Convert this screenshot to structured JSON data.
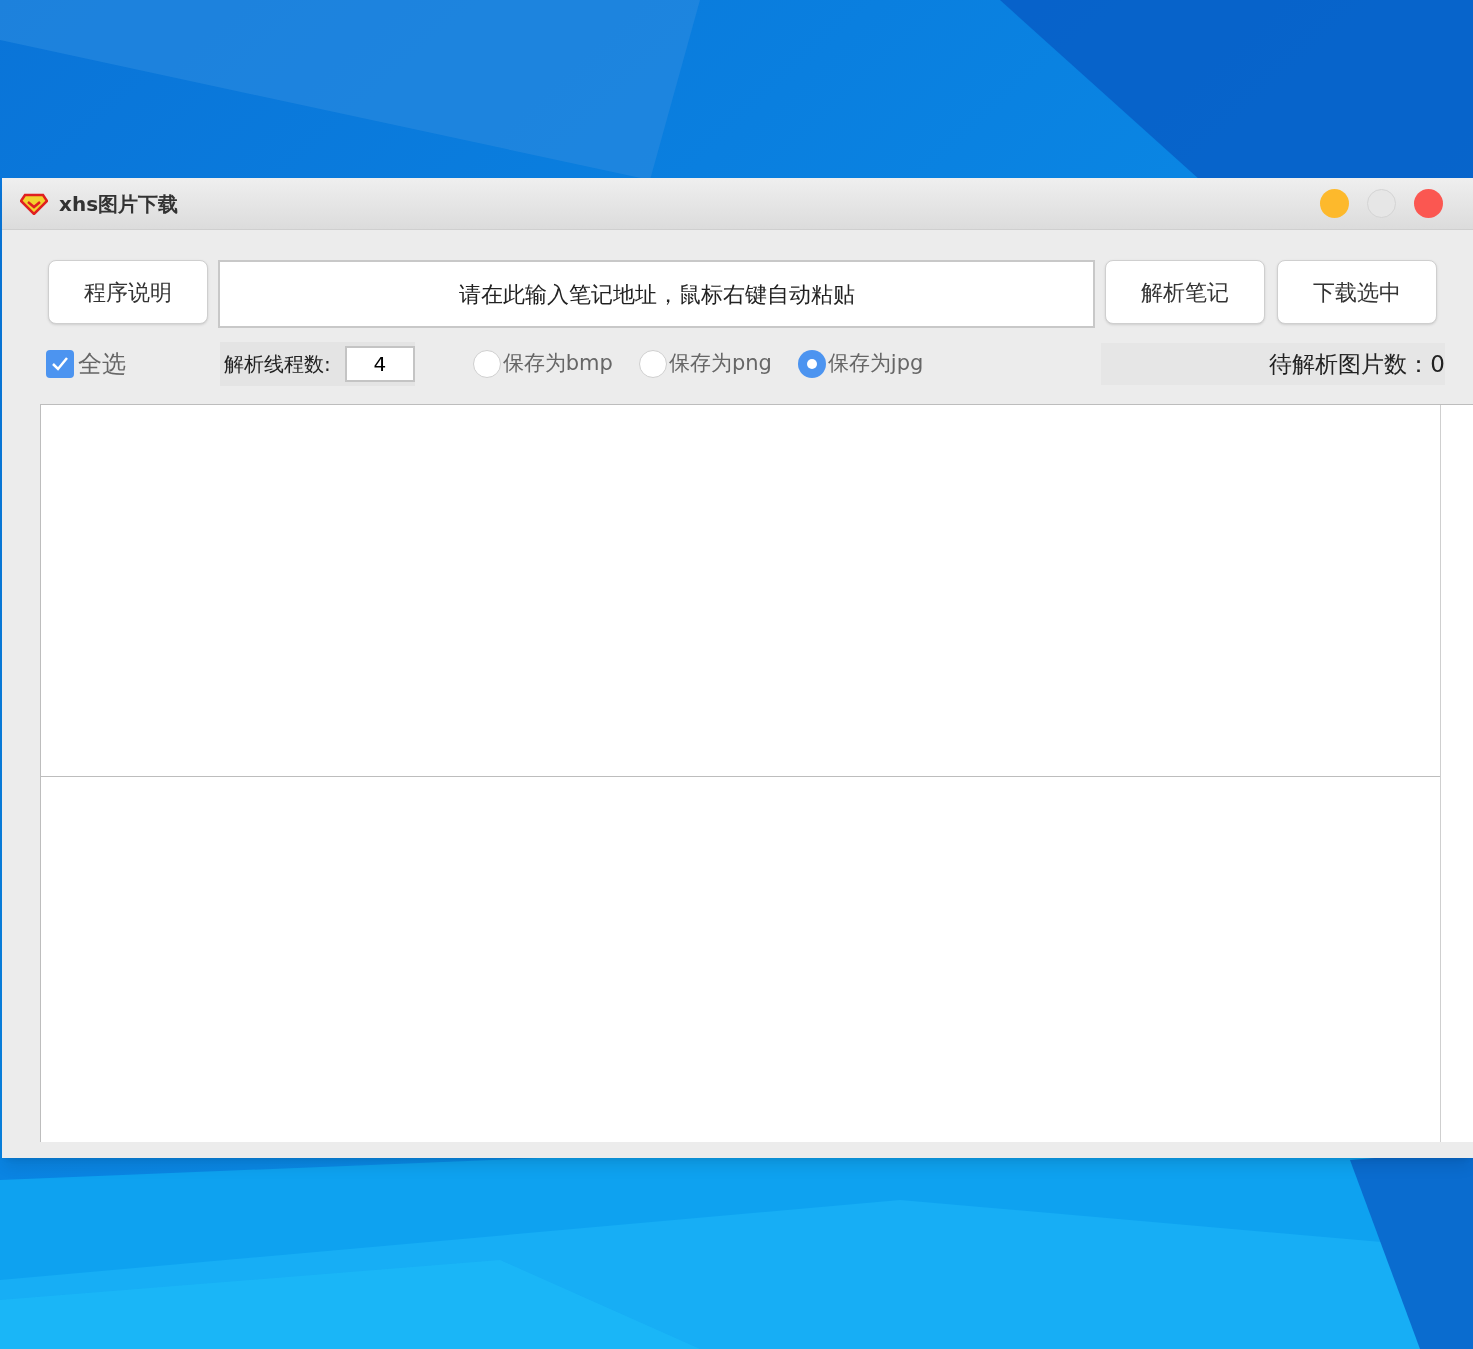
{
  "window": {
    "title": "xhs图片下载",
    "controls": [
      {
        "kind": "minimize",
        "disabled": false
      },
      {
        "kind": "maximize",
        "disabled": true
      },
      {
        "kind": "close",
        "disabled": false
      }
    ]
  },
  "toolbar": {
    "help_button": "程序说明",
    "url_field": {
      "placeholder": "请在此输入笔记地址，鼠标右键自动粘贴"
    },
    "parse_button": "解析笔记",
    "download_button": "下载选中"
  },
  "options": {
    "select_all": {
      "label": "全选",
      "checked": true
    },
    "threads": {
      "label": "解析线程数:",
      "value": "4"
    },
    "formats": [
      {
        "label": "保存为bmp",
        "selected": false
      },
      {
        "label": "保存为png",
        "selected": false
      },
      {
        "label": "保存为jpg",
        "selected": true
      }
    ],
    "pending": "待解析图片数：0"
  }
}
